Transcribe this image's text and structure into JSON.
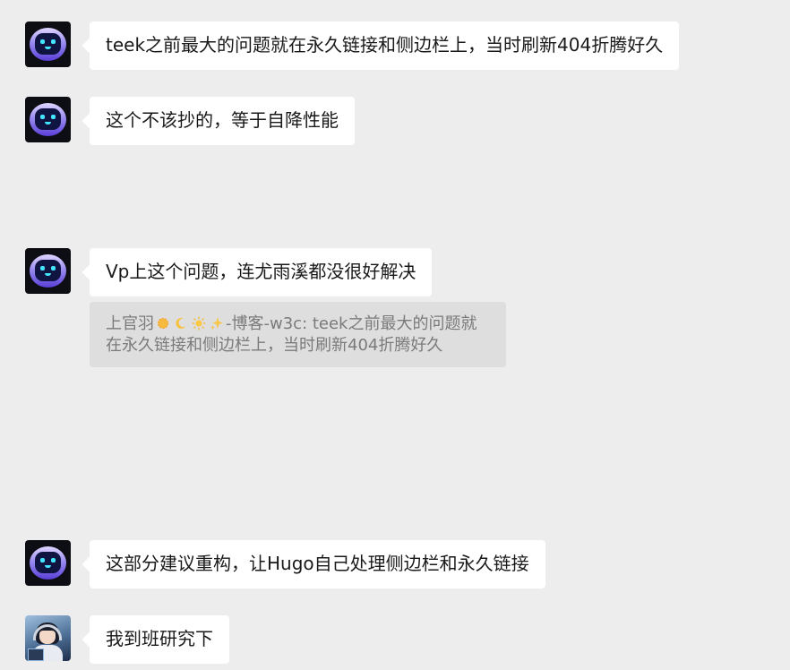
{
  "messages": [
    {
      "sender": "bot",
      "text": "teek之前最大的问题就在永久链接和侧边栏上，当时刷新404折腾好久"
    },
    {
      "sender": "bot",
      "text": "这个不该抄的，等于自降性能"
    },
    {
      "sender": "bot",
      "text": "Vp上这个问题，连尤雨溪都没很好解决",
      "quote": {
        "author_prefix": "上官羽",
        "emoji_icons": [
          "sun-icon",
          "crescent-moon-icon",
          "sun-bright-icon",
          "sparkles-icon"
        ],
        "author_suffix": "-博客-w3c",
        "text_line1": ": teek之前最大的问题就",
        "text_line2": "在永久链接和侧边栏上，当时刷新404折腾好久"
      }
    },
    {
      "sender": "bot",
      "text": "这部分建议重构，让Hugo自己处理侧边栏和永久链接"
    },
    {
      "sender": "user",
      "text": "我到班研究下"
    }
  ],
  "colors": {
    "background": "#ededed",
    "bubble": "#ffffff",
    "quote_background": "#dedede",
    "quote_text": "#7a7a7a"
  }
}
